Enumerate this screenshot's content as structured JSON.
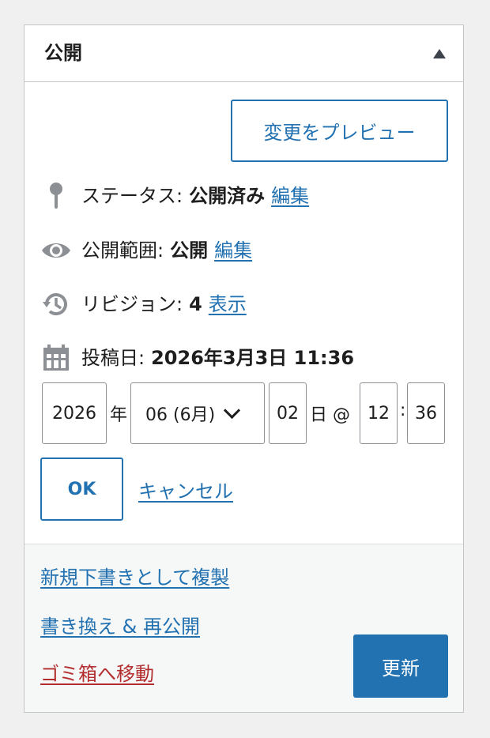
{
  "panel": {
    "title": "公開",
    "toggle_icon": "triangle-up-icon"
  },
  "preview_button": "変更をプレビュー",
  "status": {
    "icon": "pin-icon",
    "label": "ステータス:",
    "value": "公開済み",
    "edit": "編集"
  },
  "visibility": {
    "icon": "eye-icon",
    "label": "公開範囲:",
    "value": "公開",
    "edit": "編集"
  },
  "revisions": {
    "icon": "history-icon",
    "label": "リビジョン:",
    "value": "4",
    "link": "表示"
  },
  "publish_date": {
    "icon": "calendar-icon",
    "label": "投稿日:",
    "value": "2026年3月3日 11:36"
  },
  "date_editor": {
    "year": "2026",
    "year_suffix": "年",
    "month": "06 (6月)",
    "day": "02",
    "day_suffix": "日 @",
    "hour": "12",
    "time_sep": ":",
    "minute": "36"
  },
  "ok_button": "OK",
  "cancel_link": "キャンセル",
  "footer": {
    "duplicate_link": "新規下書きとして複製",
    "rewrite_link": "書き換え & 再公開",
    "trash_link": "ゴミ箱へ移動",
    "update_button": "更新"
  },
  "colors": {
    "accent": "#2271b1",
    "danger": "#b32d2e",
    "border": "#c3c4c7",
    "footer_bg": "#f6f7f7"
  }
}
